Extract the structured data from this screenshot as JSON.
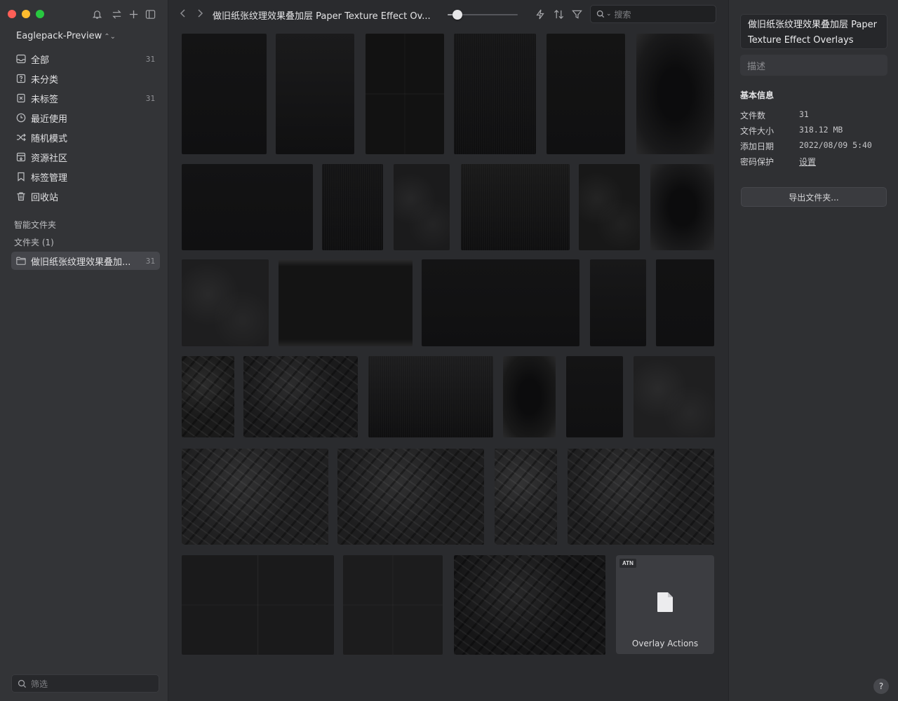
{
  "window": {
    "toolbar_title": "做旧纸张纹理效果叠加层 Paper Texture Effect Ov...",
    "search_placeholder": "搜索"
  },
  "sidebar": {
    "library_name": "Eaglepack-Preview",
    "library_chevron": "⌃",
    "nav": [
      {
        "label": "全部",
        "count": "31",
        "icon": "inbox-icon"
      },
      {
        "label": "未分类",
        "count": "",
        "icon": "question-square-icon"
      },
      {
        "label": "未标签",
        "count": "31",
        "icon": "untagged-icon"
      },
      {
        "label": "最近使用",
        "count": "",
        "icon": "clock-icon"
      },
      {
        "label": "随机模式",
        "count": "",
        "icon": "shuffle-icon"
      },
      {
        "label": "资源社区",
        "count": "",
        "icon": "community-icon"
      },
      {
        "label": "标签管理",
        "count": "",
        "icon": "tag-icon"
      },
      {
        "label": "回收站",
        "count": "",
        "icon": "trash-icon"
      }
    ],
    "smart_folders_label": "智能文件夹",
    "folders_label": "文件夹 (1)",
    "folder": {
      "label": "做旧纸张纹理效果叠加...",
      "count": "31"
    },
    "filter_placeholder": "筛选"
  },
  "toolbar": {
    "zoom_level": 0.1
  },
  "grid": {
    "tiles": [
      {
        "tone": "#141415",
        "texture": "plain"
      },
      {
        "tone": "#1b1b1c",
        "texture": "plain"
      },
      {
        "tone": "#121212",
        "texture": "fold"
      },
      {
        "tone": "#161617",
        "texture": "grain"
      },
      {
        "tone": "#141414",
        "texture": "plain"
      },
      {
        "tone": "#1a1a1b",
        "texture": "vignette"
      },
      {
        "tone": "#131314",
        "texture": "plain"
      },
      {
        "tone": "#151516",
        "texture": "grain"
      },
      {
        "tone": "#1b1b1c",
        "texture": "worn"
      },
      {
        "tone": "#1a1a1a",
        "texture": "grain"
      },
      {
        "tone": "#181818",
        "texture": "worn"
      },
      {
        "tone": "#1c1c1d",
        "texture": "vignette"
      },
      {
        "tone": "#1e1e1f",
        "texture": "worn"
      },
      {
        "tone": "#141414",
        "texture": "edge"
      },
      {
        "tone": "#141415",
        "texture": "plain"
      },
      {
        "tone": "#181819",
        "texture": "plain"
      },
      {
        "tone": "#121213",
        "texture": "plain"
      },
      {
        "tone": "#1a1a1a",
        "texture": "crumple"
      },
      {
        "tone": "#1a1a1b",
        "texture": "crumple"
      },
      {
        "tone": "#1d1d1e",
        "texture": "grain"
      },
      {
        "tone": "#191919",
        "texture": "vignette"
      },
      {
        "tone": "#141415",
        "texture": "plain"
      },
      {
        "tone": "#1f1f20",
        "texture": "worn"
      },
      {
        "tone": "#202021",
        "texture": "crumple"
      },
      {
        "tone": "#1e1e1f",
        "texture": "crumple"
      },
      {
        "tone": "#222223",
        "texture": "crumple"
      },
      {
        "tone": "#1f1f20",
        "texture": "crumple"
      },
      {
        "tone": "#1a1a1b",
        "texture": "fold"
      },
      {
        "tone": "#1c1c1d",
        "texture": "fold"
      },
      {
        "tone": "#161617",
        "texture": "crumple"
      }
    ],
    "atn_card": {
      "badge": "ATN",
      "label": "Overlay Actions"
    }
  },
  "inspector": {
    "name": "做旧纸张纹理效果叠加层 Paper Texture Effect Overlays",
    "description_placeholder": "描述",
    "info_title": "基本信息",
    "rows": [
      {
        "key": "文件数",
        "value": "31"
      },
      {
        "key": "文件大小",
        "value": "318.12 MB"
      },
      {
        "key": "添加日期",
        "value": "2022/08/09 5:40"
      },
      {
        "key": "密码保护",
        "value": "设置"
      }
    ],
    "export_label": "导出文件夹...",
    "help_label": "?"
  },
  "colors": {
    "sidebar_bg": "#333437",
    "content_bg": "#2a2b2e",
    "active_item": "#45464b",
    "close": "#ff5f57",
    "minimize": "#febc2e",
    "zoom": "#28c840"
  }
}
